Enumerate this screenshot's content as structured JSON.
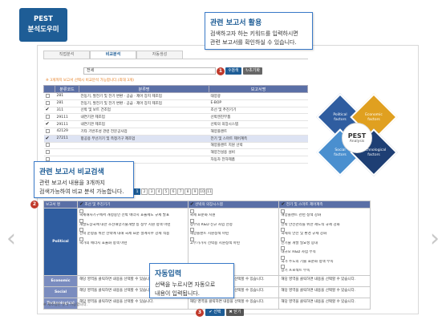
{
  "badge": {
    "line1": "PEST",
    "line2": "분석도우미"
  },
  "callouts": [
    {
      "title": "관련 보고서 활용",
      "body": "검색하고자 하는 키워드를 입력하시면\n관련 보고서를 확인하실 수 있습니다."
    },
    {
      "title": "관련 보고서 비교검색",
      "body": "관련 보고서 내용을 3개까지\n검색가능하여 비교 분석 가능합니다."
    },
    {
      "title": "자동입력",
      "body": "선택을 누르시면 자동으로\n내용이 입력됩니다."
    }
  ],
  "tabs": [
    "직접분석",
    "비교분석",
    "자동생성"
  ],
  "search": {
    "value": "전세",
    "btn_search": "검색",
    "btn_reset": "초기화"
  },
  "steps": [
    "1",
    "2",
    "3"
  ],
  "note": "※ 3개까지 보고서 선택시 비교분석 가능합니다.(최대 3개)",
  "list": {
    "headers": [
      "분류코드",
      "분류명",
      "보고서명"
    ],
    "rows": [
      {
        "checked": false,
        "code": "281",
        "name": "전동기, 발전기 및 전기 변환 · 공급 · 제어 장치 제조업",
        "report": "태양광"
      },
      {
        "checked": false,
        "code": "281",
        "name": "전동기, 발전기 및 전기 변환 · 공급 · 제어 장치 제조업",
        "report": "E-BOP"
      },
      {
        "checked": true,
        "code": "311",
        "name": "선박 및 보트 건조업",
        "report": "조선 및 추진기기"
      },
      {
        "checked": false,
        "code": "29111",
        "name": "내연기관 제조업",
        "report": "선박엔진부품"
      },
      {
        "checked": true,
        "code": "29111",
        "name": "내연기관 제조업",
        "report": "선박의 의장시스템"
      },
      {
        "checked": false,
        "code": "42129",
        "name": "기타 기반조성 관련 전문공사업",
        "report": "해양플랜트"
      },
      {
        "checked": true,
        "code": "27211",
        "name": "항공용 무선기기 및 측정기구 제조업",
        "report": "전기 및 스마트 제어계측"
      },
      {
        "checked": false,
        "code": "",
        "name": "",
        "report": "해양플랜트 지원 선박"
      },
      {
        "checked": false,
        "code": "",
        "name": "",
        "report": "해양건설용 설비"
      },
      {
        "checked": false,
        "code": "",
        "name": "",
        "report": "자동차 전자제품"
      }
    ]
  },
  "pager": [
    "1",
    "2",
    "3",
    "4",
    "5",
    "6",
    "7",
    "8",
    "9",
    "10",
    "11"
  ],
  "pest_diagram": {
    "center_title": "PEST",
    "center_sub": "Analysis",
    "political": "Political",
    "economic": "Economic",
    "social": "Social",
    "technological": "Technological",
    "factors": "factors"
  },
  "compare": {
    "head_label": "보고서 명",
    "columns": [
      "조선 및 추진기기",
      "선박의 의장시스템",
      "전기 및 스마트 제어계측"
    ],
    "political_label": "Political",
    "political_cells": [
      [
        "국제해사기구에서 개정중인 선박 에너지 효율제도 규제 발표",
        "개발도상국에 대한 조선해양기술개발 등 정부 지원 정책 마련",
        "선박 운항을 위한 선박에 대해 국제 표준 설계지수 강제 적용",
        "국가의 에너지 효율화 정책 마련"
      ],
      [
        "국제 표준화 지원",
        "정부의 R&D 신규 사업 선정",
        "해양플랜트 지원정책 마련",
        "고부가가치 선박용 지원정책 마련"
      ],
      [
        "해양플랜트 관련 정책 강화",
        "선박 안전관리를 위한 제도적 규제 강화",
        "국제적 안전 및 환경 규제 강화",
        "신기술 개발 필요성 증대",
        "대규모 R&D 사업 부족",
        "국가 주도의 기술 표준화 정책 부족",
        "장기 프로젝트 부족"
      ]
    ],
    "other_rows": [
      {
        "label": "Economic",
        "cells": [
          "해당 영역을 클릭하면 내용을 선택할 수 있습니다.",
          "해당 영역을 클릭하면 내용을 선택할 수 있습니다.",
          "해당 영역을 클릭하면 내용을 선택할 수 있습니다."
        ]
      },
      {
        "label": "Social",
        "cells": [
          "해당 영역을 클릭하면 내용을 선택할 수 있습니다.",
          "해당 영역을 클릭하면 내용을 선택할 수 있습니다.",
          "해당 영역을 클릭하면 내용을 선택할 수 있습니다."
        ]
      },
      {
        "label": "Technological",
        "cells": [
          "해당 영역을 클릭하면 내용을 선택할 수 있습니다.",
          "해당 영역을 클릭하면 내용을 선택할 수 있습니다.",
          "해당 영역을 클릭하면 내용을 선택할 수 있습니다."
        ]
      }
    ]
  },
  "buttons": {
    "select": "선택",
    "close": "닫기"
  },
  "foot_note": "※ 제조업만 분석 가능합니다.",
  "nav": {
    "prev": "‹",
    "next": "›"
  },
  "colors": {
    "primary": "#1e5d96",
    "header": "#5a6fa6",
    "political": "#2f5da0",
    "economic": "#e0a020",
    "social": "#4a8fcf",
    "technological": "#1e3f74"
  }
}
